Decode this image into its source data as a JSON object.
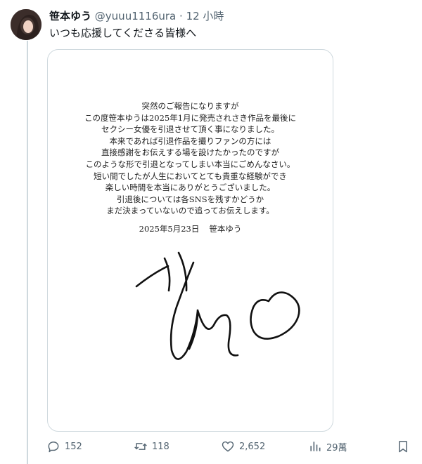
{
  "author": {
    "display_name": "笹本ゆう",
    "handle": "@yuuu1116ura",
    "separator": "·",
    "time_ago": "12 小時",
    "avatar": "avatar-photo"
  },
  "tweet": {
    "text": "いつも応援してくださる皆様へ"
  },
  "letter": {
    "lines": [
      "突然のご報告になりますが",
      "この度笹本ゆうは2025年1月に発売されさき作品を最後に",
      "セクシー女優を引退させて頂く事になりました。",
      "本来であれば引退作品を撮りファンの方には",
      "直接感謝をお伝えする場を設けたかったのですが",
      "このような形で引退となってしまい本当にごめんなさい。",
      "短い間でしたが人生においてとても貴重な経験ができ",
      "楽しい時間を本当にありがとうございました。",
      "引退後については各SNSを残すかどうか",
      "まだ決まっていないので追ってお伝えします。"
    ],
    "date": "2025年5月23日",
    "signed_name": "笹本ゆう"
  },
  "actions": {
    "replies": "152",
    "reposts": "118",
    "likes": "2,652",
    "views": "29萬",
    "icons": [
      "reply-icon",
      "repost-icon",
      "like-icon",
      "views-icon",
      "bookmark-icon"
    ]
  }
}
